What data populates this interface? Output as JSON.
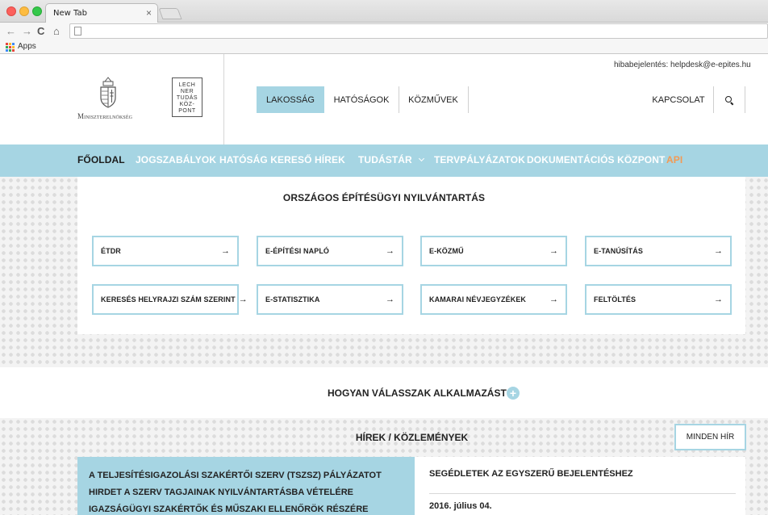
{
  "browser": {
    "tab_title": "New Tab",
    "tab_close": "×",
    "back_icon": "←",
    "forward_icon": "→",
    "reload_icon": "C",
    "home_icon": "⌂",
    "bookmarks_apps": "Apps",
    "apps_colors": [
      "#e8453c",
      "#f9bb2d",
      "#3d8af7",
      "#34a853",
      "#e8453c",
      "#f9bb2d",
      "#3d8af7",
      "#34a853",
      "#e8453c"
    ]
  },
  "header": {
    "ministry_text": "Miniszterelnökség",
    "lechner_lines": [
      "LECH",
      "NER",
      "TUDÁS",
      "KÖZ-",
      "PONT"
    ],
    "helpdesk": "hibabejelentés: helpdesk@e-epites.hu",
    "segments": [
      {
        "label": "LAKOSSÁG",
        "active": true
      },
      {
        "label": "HATÓSÁGOK",
        "active": false
      },
      {
        "label": "KÖZMŰVEK",
        "active": false
      }
    ],
    "contact": "KAPCSOLAT"
  },
  "nav": {
    "items": [
      "FŐOLDAL",
      "JOGSZABÁLYOK",
      "HATÓSÁG KERESŐ",
      "HÍREK",
      "TUDÁSTÁR",
      "TERVPÁLYÁZATOK",
      "DOKUMENTÁCIÓS KÖZPONT",
      "API"
    ],
    "accent_color": "#a6d5e3",
    "api_color": "#f39a54"
  },
  "registry": {
    "title": "ORSZÁGOS ÉPÍTÉSÜGYI NYILVÁNTARTÁS",
    "cards": [
      "ÉTDR",
      "E-ÉPÍTÉSI NAPLÓ",
      "E-KÖZMŰ",
      "E-TANÚSÍTÁS",
      "KERESÉS HELYRAJZI SZÁM SZERINT",
      "E-STATISZTIKA",
      "KAMARAI NÉVJEGYZÉKEK",
      "FELTÖLTÉS"
    ],
    "arrow": "→"
  },
  "choose": {
    "label": "HOGYAN VÁLASSZAK ALKALMAZÁST?",
    "plus": "+"
  },
  "news": {
    "title": "HÍREK / KÖZLEMÉNYEK",
    "all_button": "MINDEN HÍR",
    "left_title": "A TELJESÍTÉSIGAZOLÁSI SZAKÉRTŐI SZERV (TSZSZ) PÁLYÁZATOT HIRDET A SZERV TAGJAINAK NYILVÁNTARTÁSBA VÉTELÉRE IGAZSÁGÜGYI SZAKÉRTŐK ÉS MŰSZAKI ELLENŐRÖK RÉSZÉRE",
    "right_title": "SEGÉDLETEK AZ EGYSZERŰ BEJELENTÉSHEZ",
    "right_date": "2016. július 04."
  }
}
